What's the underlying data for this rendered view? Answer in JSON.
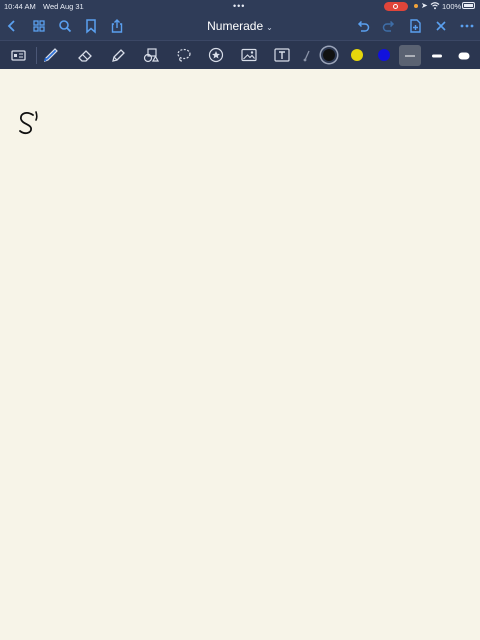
{
  "status_bar": {
    "time": "10:44 AM",
    "date": "Wed Aug 31",
    "multitask_dots": "•••",
    "battery": "100%"
  },
  "top_bar": {
    "document_title": "Numerade",
    "title_chevron": "⌄",
    "left_icons": [
      "back-chevron-icon",
      "grid-thumbnails-icon",
      "search-icon",
      "bookmark-icon",
      "share-icon"
    ],
    "right_icons": [
      "undo-icon",
      "redo-icon",
      "add-page-icon",
      "close-icon",
      "more-icon"
    ],
    "accent_color": "#5aa0f0"
  },
  "toolbar": {
    "tools": [
      "read-mode-icon",
      "pen-icon",
      "eraser-icon",
      "highlighter-icon",
      "shapes-icon",
      "lasso-icon",
      "elements-icon",
      "image-icon",
      "text-box-icon",
      "laser-pointer-icon"
    ],
    "selected_tool": "pen-icon",
    "colors": [
      "#111111",
      "#e5d60c",
      "#1111dd"
    ],
    "selected_color": "#111111",
    "stroke_widths": [
      "thin",
      "medium",
      "thick"
    ],
    "selected_stroke": "thin"
  },
  "canvas": {
    "background": "#f7f4e8",
    "handwritten_text": "S'"
  }
}
